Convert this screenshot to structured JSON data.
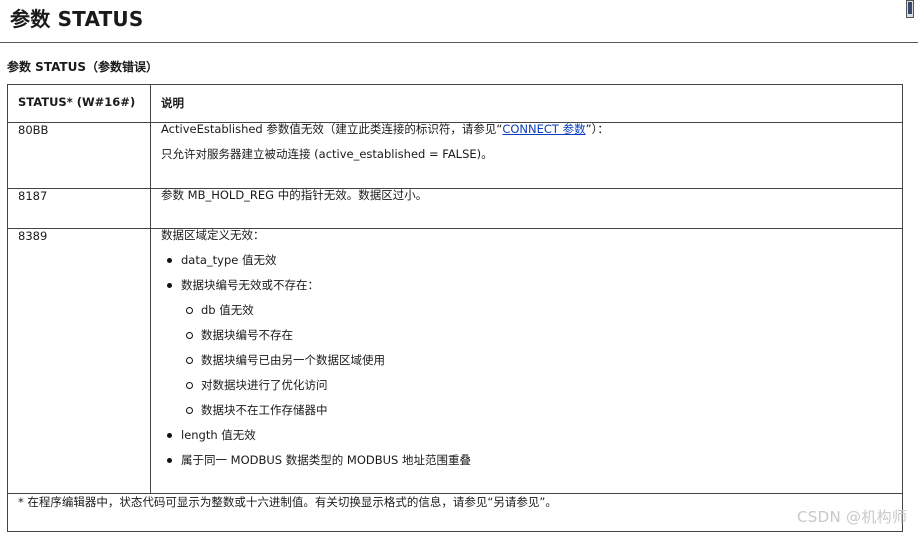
{
  "page": {
    "title": "参数 STATUS",
    "section_heading": "参数 STATUS（参数错误）"
  },
  "table": {
    "headers": [
      "STATUS* (W#16#)",
      "说明"
    ],
    "rows": [
      {
        "code": "80BB",
        "line1_before": "ActiveEstablished 参数值无效（建立此类连接的标识符，请参见“",
        "line1_link": "CONNECT 参数",
        "line1_after": "”）：",
        "line2": "只允许对服务器建立被动连接 (active_established = FALSE)。"
      },
      {
        "code": "8187",
        "text": "参数 MB_HOLD_REG 中的指针无效。数据区过小。"
      },
      {
        "code": "8389",
        "intro": "数据区域定义无效：",
        "bullets": [
          "data_type 值无效",
          "数据块编号无效或不存在：",
          "length 值无效",
          "属于同一 MODBUS 数据类型的 MODBUS 地址范围重叠"
        ],
        "sub_bullets": [
          "db 值无效",
          "数据块编号不存在",
          "数据块编号已由另一个数据区域使用",
          "对数据块进行了优化访问",
          "数据块不在工作存储器中"
        ]
      }
    ],
    "footnote": "* 在程序编辑器中，状态代码可显示为整数或十六进制值。有关切换显示格式的信息，请参见“另请参见”。"
  },
  "watermark": "CSDN @机构师"
}
